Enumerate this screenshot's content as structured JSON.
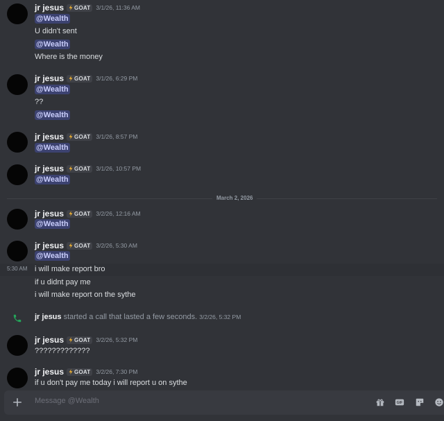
{
  "recipient": "Wealth",
  "user": {
    "name": "jr jesus",
    "tag": "GOAT"
  },
  "messages": [
    {
      "time": "3/1/26, 11:36 AM",
      "lines": [
        "@Wealth",
        "U didn't sent",
        "@Wealth",
        "Where is the money"
      ]
    },
    {
      "time": "3/1/26, 6:29 PM",
      "lines": [
        "@Wealth",
        "??",
        "@Wealth"
      ]
    },
    {
      "time": "3/1/26, 8:57 PM",
      "lines": [
        "@Wealth"
      ]
    },
    {
      "time": "3/1/26, 10:57 PM",
      "lines": [
        "@Wealth"
      ]
    },
    {
      "time": "3/2/26, 12:16 AM",
      "lines": [
        "@Wealth"
      ]
    },
    {
      "time": "3/2/26, 5:30 AM",
      "lines": [
        "@Wealth",
        "i will make report bro",
        "if u didnt pay me",
        "i will make report on the sythe"
      ],
      "hover_time": "5:30 AM"
    },
    {
      "time": "3/2/26, 5:32 PM",
      "lines": [
        "?????????????"
      ]
    },
    {
      "time": "3/2/26, 7:30 PM",
      "lines": [
        "if u don't pay me today i will report u on sythe"
      ]
    }
  ],
  "date_divider": "March 2, 2026",
  "call": {
    "name": "jr jesus",
    "text": "started a call that lasted a few seconds.",
    "time": "3/2/26, 5:32 PM"
  },
  "composer": {
    "placeholder": "Message @Wealth"
  },
  "icons": {
    "add": "plus-circle-icon",
    "gift": "gift-icon",
    "gif": "gif-icon",
    "sticker": "sticker-icon",
    "emoji": "emoji-icon",
    "call": "phone-icon",
    "tag": "lightning-icon"
  },
  "colors": {
    "background": "#313338",
    "mention_bg": "#3c4270",
    "mention_text": "#c9cdfb",
    "call_green": "#23a559"
  }
}
